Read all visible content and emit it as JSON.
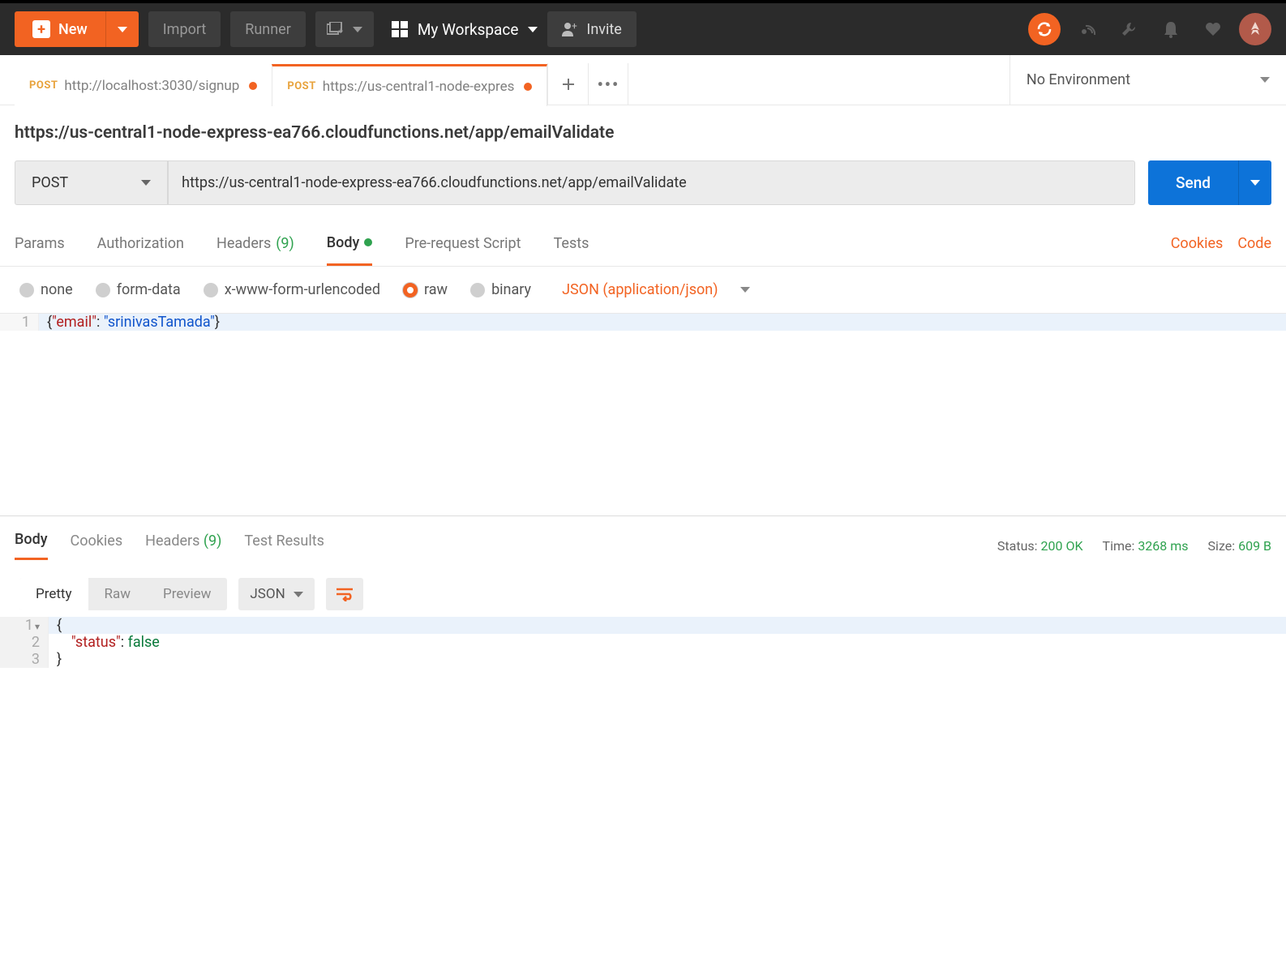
{
  "topbar": {
    "new_label": "New",
    "import_label": "Import",
    "runner_label": "Runner",
    "workspace_label": "My Workspace",
    "invite_label": "Invite"
  },
  "tabs": [
    {
      "method": "POST",
      "title": "http://localhost:3030/signup",
      "dirty": true,
      "active": false
    },
    {
      "method": "POST",
      "title": "https://us-central1-node-expres",
      "dirty": true,
      "active": true
    }
  ],
  "environment": {
    "label": "No Environment"
  },
  "request": {
    "name": "https://us-central1-node-express-ea766.cloudfunctions.net/app/emailValidate",
    "method": "POST",
    "url": "https://us-central1-node-express-ea766.cloudfunctions.net/app/emailValidate",
    "send_label": "Send"
  },
  "subtabs": {
    "params": "Params",
    "authorization": "Authorization",
    "headers": "Headers",
    "headers_count": "(9)",
    "body": "Body",
    "prerequest": "Pre-request Script",
    "tests": "Tests",
    "cookies": "Cookies",
    "code": "Code"
  },
  "body_types": {
    "none": "none",
    "formdata": "form-data",
    "urlencoded": "x-www-form-urlencoded",
    "raw": "raw",
    "binary": "binary",
    "content_type": "JSON (application/json)"
  },
  "request_body": {
    "line1_key": "\"email\"",
    "line1_val": "\"srinivasTamada\""
  },
  "response": {
    "tabs": {
      "body": "Body",
      "cookies": "Cookies",
      "headers": "Headers",
      "headers_count": "(9)",
      "test_results": "Test Results"
    },
    "status_label": "Status:",
    "status_value": "200 OK",
    "time_label": "Time:",
    "time_value": "3268 ms",
    "size_label": "Size:",
    "size_value": "609 B",
    "views": {
      "pretty": "Pretty",
      "raw": "Raw",
      "preview": "Preview"
    },
    "format": "JSON",
    "body": {
      "line2_key": "\"status\"",
      "line2_val": "false"
    }
  }
}
